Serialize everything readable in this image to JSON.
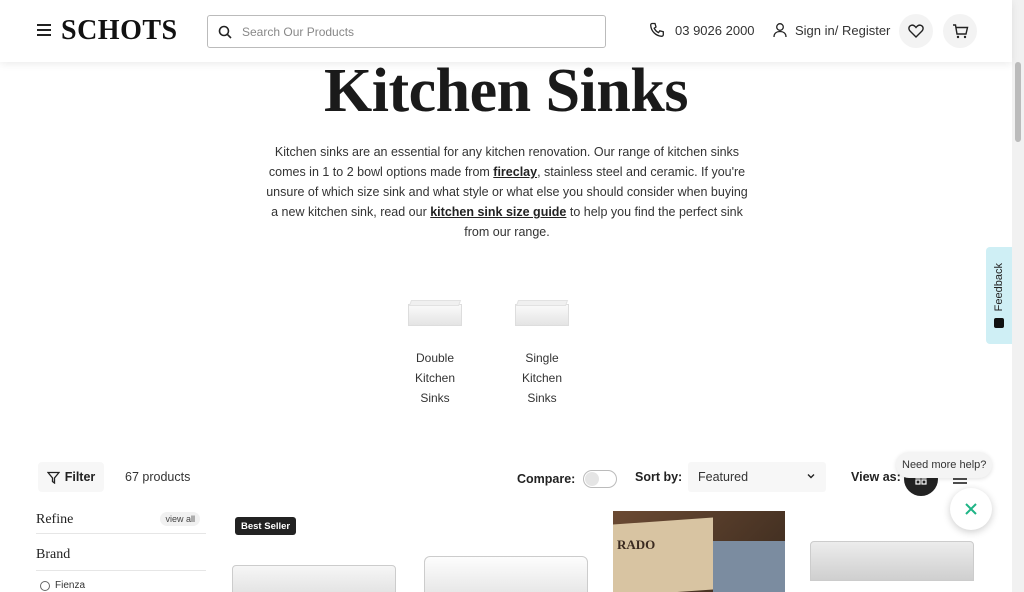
{
  "header": {
    "logo": "SCHOTS",
    "search_placeholder": "Search Our Products",
    "phone": "03 9026 2000",
    "signin": "Sign in/ Register"
  },
  "hero": {
    "title": "Kitchen Sinks",
    "intro_1": "Kitchen sinks are an essential for any kitchen renovation. Our range of kitchen sinks comes in 1 to 2 bowl options made from ",
    "intro_link_1": "fireclay",
    "intro_2": ", stainless steel and ceramic. If you're unsure of which size sink and what style or what else you should consider when buying a new kitchen sink, read our ",
    "intro_link_2": "kitchen sink size guide",
    "intro_3": " to help you find the perfect sink from our range."
  },
  "categories": [
    {
      "line1": "Double",
      "line2": "Kitchen Sinks"
    },
    {
      "line1": "Single",
      "line2": "Kitchen Sinks"
    }
  ],
  "toolbar": {
    "filter_label": "Filter",
    "count": "67 products",
    "compare_label": "Compare:",
    "sort_label": "Sort by:",
    "sort_value": "Featured",
    "view_label": "View as:"
  },
  "sidebar": {
    "refine": "Refine",
    "view_all": "view all",
    "brand": "Brand",
    "brand_option": "Fienza"
  },
  "products": {
    "badge": "Best Seller",
    "p3_stamp": "RADO"
  },
  "chat": {
    "help_text": "Need more help?"
  },
  "feedback": {
    "label": "Feedback"
  },
  "colors": {
    "feedback_bg": "#cfeff5",
    "chat_accent": "#1fb486"
  }
}
